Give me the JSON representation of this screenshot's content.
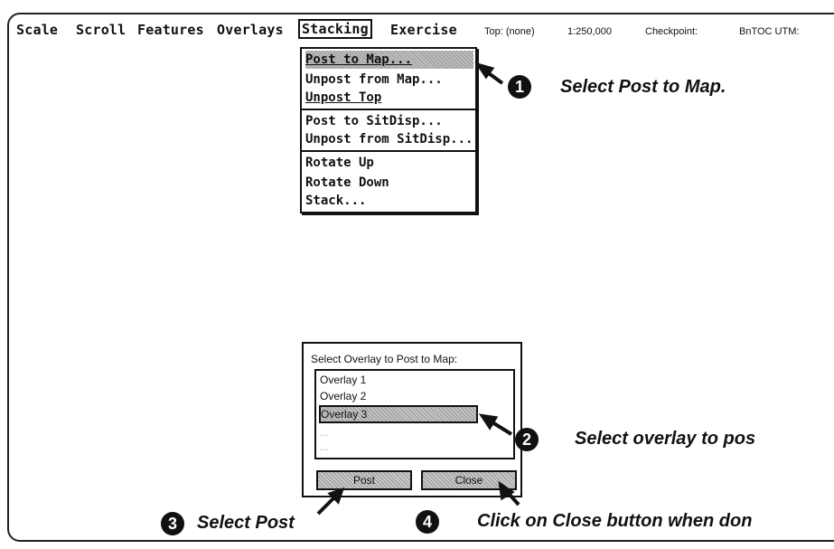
{
  "menubar": {
    "items": [
      "Scale",
      "Scroll",
      "Features",
      "Overlays",
      "Stacking",
      "Exercise"
    ],
    "active_item": "Stacking",
    "status": {
      "top": "Top: (none)",
      "scale": "1:250,000",
      "checkpoint": "Checkpoint:",
      "bntoc": "BnTOC UTM:"
    }
  },
  "dropdown": {
    "items": [
      "Post to Map...",
      "Unpost from Map...",
      "Unpost Top",
      "Post to SitDisp...",
      "Unpost from SitDisp...",
      "Rotate Up",
      "Rotate Down",
      "Stack..."
    ],
    "highlighted_index": 0
  },
  "dialog": {
    "title": "Select Overlay to Post to Map:",
    "list_items": [
      "Overlay 1",
      "Overlay 2",
      "Overlay 3"
    ],
    "selected_index": 2,
    "faint_rows": [
      "...",
      "..."
    ],
    "buttons": {
      "post": "Post",
      "close": "Close"
    }
  },
  "callouts": {
    "step1": {
      "number": "1",
      "text": "Select Post to Map."
    },
    "step2": {
      "number": "2",
      "text": "Select overlay to pos"
    },
    "step3": {
      "number": "3",
      "text": "Select Post"
    },
    "step4": {
      "number": "4",
      "text": "Click on Close button when don"
    }
  }
}
